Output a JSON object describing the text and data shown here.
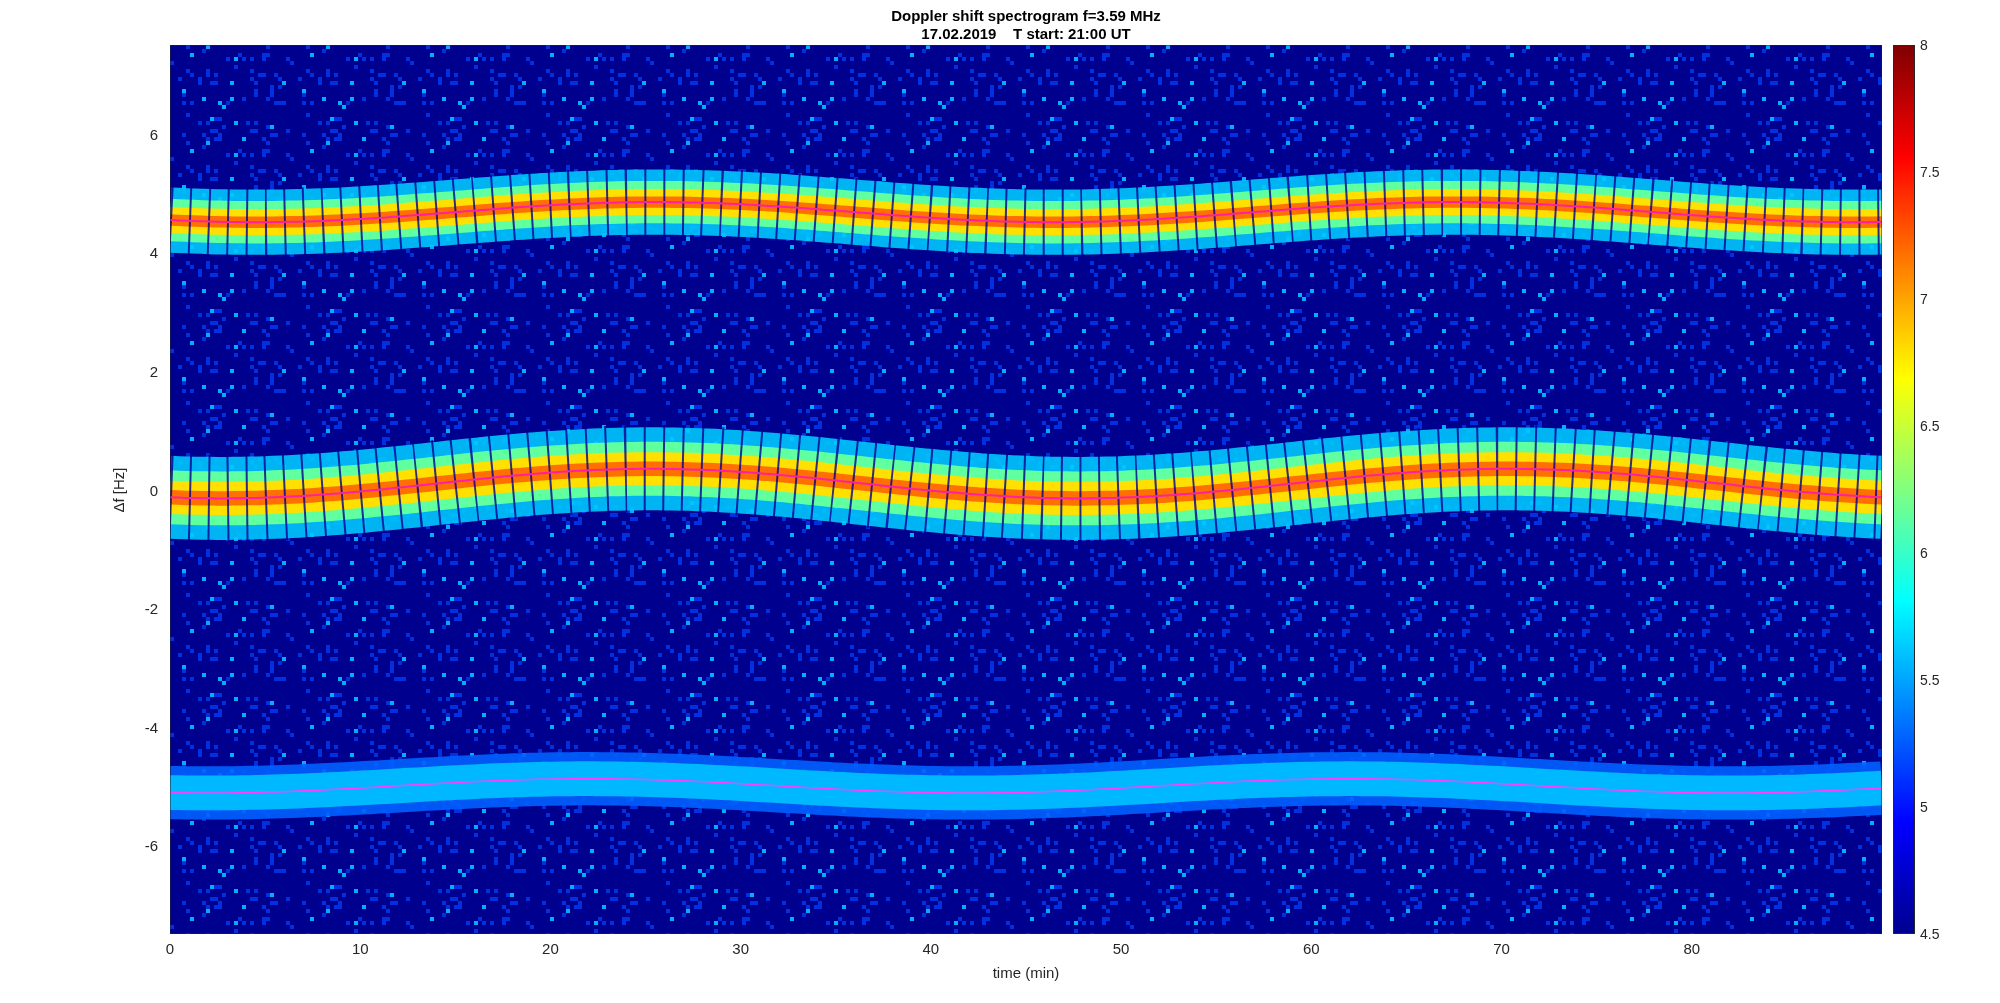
{
  "figure": {
    "title": "Doppler shift spectrogram f=3.59 MHz",
    "subtitle": "17.02.2019    T start: 21:00 UT"
  },
  "axes": {
    "xlabel": "time (min)",
    "ylabel": "Δf [Hz]",
    "xticks": [
      "0",
      "10",
      "20",
      "30",
      "40",
      "50",
      "60",
      "70",
      "80"
    ],
    "yticks": [
      "6",
      "4",
      "2",
      "0",
      "-2",
      "-4",
      "-6"
    ]
  },
  "colorbar": {
    "ticks": [
      "8",
      "7.5",
      "7",
      "6.5",
      "6",
      "5.5",
      "5",
      "4.5"
    ]
  }
}
